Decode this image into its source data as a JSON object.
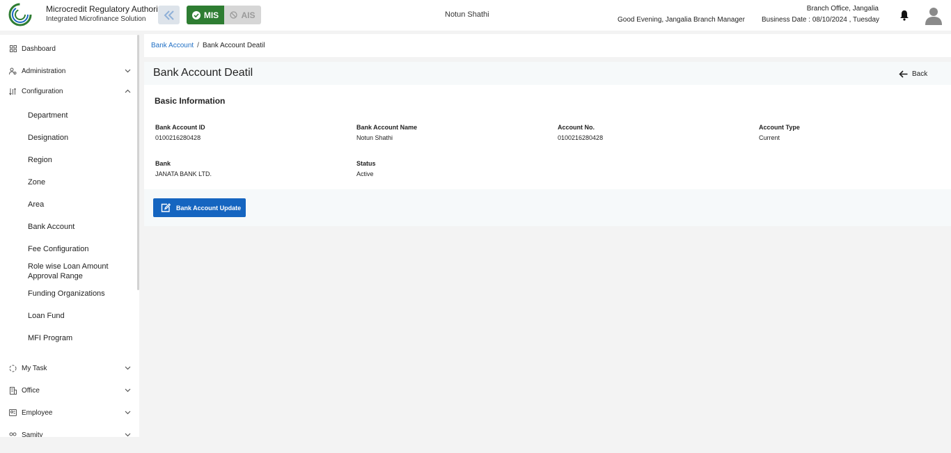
{
  "header": {
    "org_title": "Microcredit Regulatory Authority",
    "org_subtitle": "Integrated Microfinance Solution",
    "logo_text": "Microcredit Regulatory Authority",
    "mode_mis": "MIS",
    "mode_ais": "AIS",
    "center_name": "Notun Shathi",
    "greeting": "Good Evening, Jangalia Branch Manager",
    "branch_office": "Branch Office, Jangalia",
    "business_date": "Business Date : 08/10/2024 , Tuesday",
    "accent_color": "#2e7d32"
  },
  "sidebar": {
    "items": [
      {
        "label": "Dashboard",
        "icon": "grid-icon"
      },
      {
        "label": "Administration",
        "icon": "users-cog-icon"
      },
      {
        "label": "Configuration",
        "icon": "sort-icon"
      },
      {
        "label": "My Task",
        "icon": "spinner-icon"
      },
      {
        "label": "Office",
        "icon": "building-icon"
      },
      {
        "label": "Employee",
        "icon": "id-badge-icon"
      },
      {
        "label": "Samity",
        "icon": "group-icon"
      }
    ],
    "config_children": [
      "Department",
      "Designation",
      "Region",
      "Zone",
      "Area",
      "Bank Account",
      "Fee Configuration",
      "Role wise Loan Amount Approval Range",
      "Funding Organizations",
      "Loan Fund",
      "MFI Program"
    ]
  },
  "breadcrumb": {
    "parent": "Bank Account",
    "separator": "/",
    "current": "Bank Account Deatil"
  },
  "page": {
    "title": "Bank Account Deatil",
    "back_label": "Back",
    "section_title": "Basic Information",
    "fields": [
      {
        "label": "Bank Account ID",
        "value": "0100216280428"
      },
      {
        "label": "Bank Account Name",
        "value": "Notun Shathi"
      },
      {
        "label": "Account No.",
        "value": "0100216280428"
      },
      {
        "label": "Account Type",
        "value": "Current"
      },
      {
        "label": "Bank",
        "value": "JANATA BANK LTD."
      },
      {
        "label": "Status",
        "value": "Active"
      }
    ],
    "update_button": "Bank Account Update",
    "primary_color": "#1565c0"
  }
}
